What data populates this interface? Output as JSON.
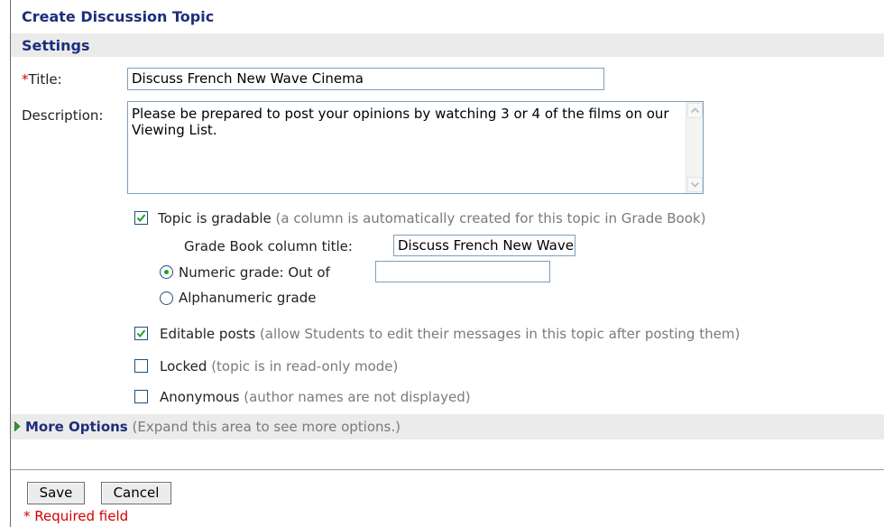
{
  "header": {
    "title": "Create Discussion Topic",
    "section": "Settings"
  },
  "form": {
    "title_label": "Title:",
    "title_required_marker": "*",
    "title_value": "Discuss French New Wave Cinema",
    "description_label": "Description:",
    "description_value": "Please be prepared to post your opinions by watching 3 or 4 of the films on our Viewing List.",
    "gradable": {
      "checked": true,
      "label": "Topic is gradable",
      "hint": "(a column is automatically created for this topic in Grade Book)"
    },
    "grade_column_label": "Grade Book column title:",
    "grade_column_value": "Discuss French New Wave Cinema",
    "numeric_grade": {
      "selected": true,
      "label": "Numeric grade: Out of",
      "value": ""
    },
    "alphanumeric_grade": {
      "selected": false,
      "label": "Alphanumeric grade"
    },
    "editable_posts": {
      "checked": true,
      "label": "Editable posts",
      "hint": "(allow Students to edit their messages in this topic after posting them)"
    },
    "locked": {
      "checked": false,
      "label": "Locked",
      "hint": "(topic is in read-only mode)"
    },
    "anonymous": {
      "checked": false,
      "label": "Anonymous",
      "hint": "(author names are not displayed)"
    }
  },
  "more_options": {
    "label": "More Options",
    "hint": "(Expand this area to see more options.)"
  },
  "actions": {
    "save_label": "Save",
    "cancel_label": "Cancel"
  },
  "footer": {
    "required_note": "* Required field"
  },
  "colors": {
    "heading": "#1f2e7a",
    "required": "#d40000",
    "hint": "#7a7a7a",
    "section_bg": "#ebebeb",
    "check_mark": "#21a121"
  }
}
